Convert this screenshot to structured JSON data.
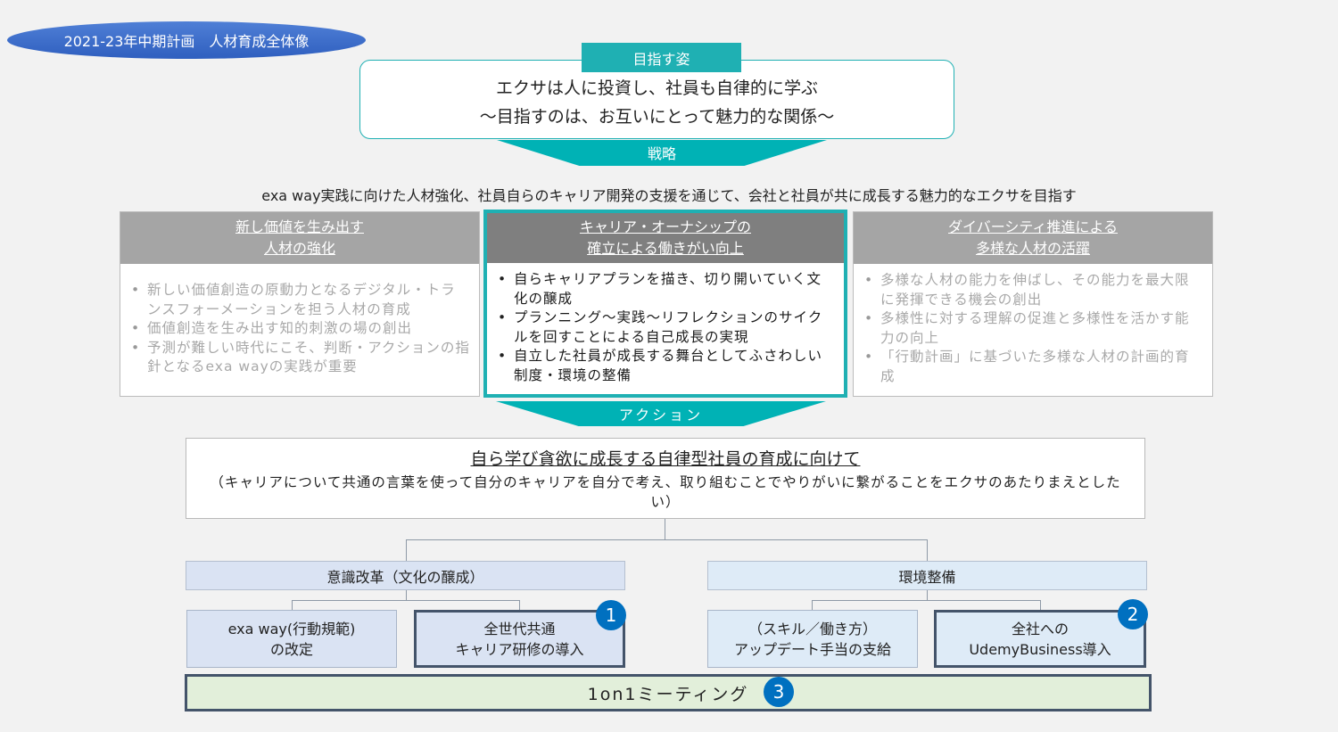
{
  "title": "2021-23年中期計画　人材育成全体像",
  "vision": {
    "tab_label": "目指す姿",
    "line1": "エクサは人に投資し、社員も自律的に学ぶ",
    "line2": "〜目指すのは、お互いにとって魅力的な関係〜"
  },
  "strategy": {
    "arrow_label": "戦略",
    "statement": "exa way実践に向けた人材強化、社員自らのキャリア開発の支援を通じて、会社と社員が共に成長する魅力的なエクサを目指す"
  },
  "pillars": [
    {
      "heading_line1": "新し価値を生み出す",
      "heading_line2": "人材の強化",
      "bullets": [
        "新しい価値創造の原動力となるデジタル・トランスフォーメーションを担う人材の育成",
        "価値創造を生み出す知的刺激の場の創出",
        "予測が難しい時代にこそ、判断・アクションの指針となるexa wayの実践が重要"
      ]
    },
    {
      "heading_line1": "キャリア・オーナシップの",
      "heading_line2": "確立による働きがい向上",
      "bullets": [
        "自らキャリアプランを描き、切り開いていく文化の醸成",
        "プランニング〜実践〜リフレクションのサイクルを回すことによる自己成長の実現",
        "自立した社員が成長する舞台としてふさわしい制度・環境の整備"
      ]
    },
    {
      "heading_line1": "ダイバーシティ推進による",
      "heading_line2": "多様な人材の活躍",
      "bullets": [
        "多様な人材の能力を伸ばし、その能力を最大限に発揮できる機会の創出",
        "多様性に対する理解の促進と多様性を活かす能力の向上",
        "「行動計画」に基づいた多様な人材の計画的育成"
      ]
    }
  ],
  "action": {
    "arrow_label": "アクション",
    "title": "自ら学び貪欲に成長する自律型社員の育成に向けて",
    "description": "（キャリアについて共通の言葉を使って自分のキャリアを自分で考え、取り組むことでやりがいに繋がることをエクサのあたりまえとしたい）"
  },
  "categories": {
    "left": "意識改革（文化の醸成）",
    "right": "環境整備"
  },
  "initiatives": [
    {
      "line1": "exa way(行動規範)",
      "line2": "の改定"
    },
    {
      "line1": "全世代共通",
      "line2": "キャリア研修の導入",
      "badge": "1"
    },
    {
      "line1": "（スキル／働き方）",
      "line2": "アップデート手当の支給"
    },
    {
      "line1": "全社への",
      "line2": "UdemyBusiness導入",
      "badge": "2"
    }
  ],
  "meeting": {
    "label": "1on1ミーティング",
    "badge": "3"
  },
  "colors": {
    "teal": "#1fb0b3",
    "title_blue": "#2f5fbf",
    "badge_blue": "#0070c0",
    "meeting_green": "#e2efda",
    "category_blue": "#dae3f3",
    "dark_border": "#44546a"
  }
}
